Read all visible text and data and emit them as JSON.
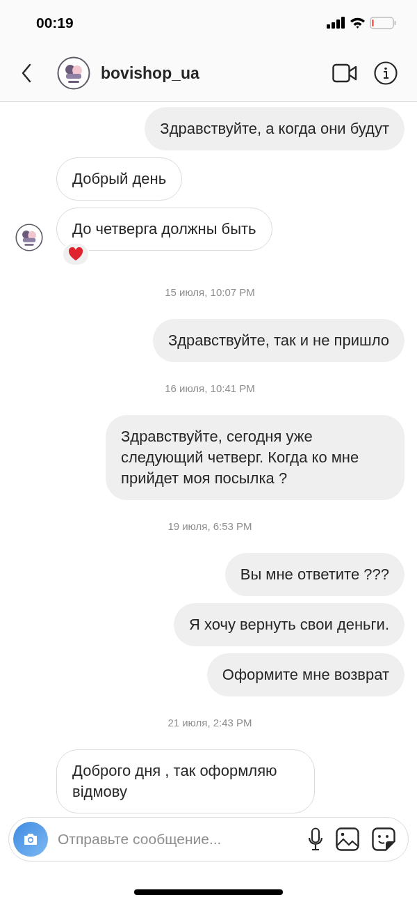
{
  "status_bar": {
    "time": "00:19"
  },
  "header": {
    "username": "bovishop_ua"
  },
  "messages": [
    {
      "kind": "sent",
      "text": "Здравствуйте, а когда они будут"
    },
    {
      "kind": "received",
      "text": "Добрый день",
      "avatar": false
    },
    {
      "kind": "received",
      "text": "До четверга должны быть",
      "avatar": true,
      "reacted": true
    },
    {
      "kind": "timestamp",
      "text": "15 июля, 10:07 PM"
    },
    {
      "kind": "sent",
      "text": "Здравствуйте, так и не пришло"
    },
    {
      "kind": "timestamp",
      "text": "16 июля, 10:41 PM"
    },
    {
      "kind": "sent",
      "text": "Здравствуйте, сегодня уже следующий четверг. Когда ко мне прийдет моя посылка ?"
    },
    {
      "kind": "timestamp",
      "text": "19 июля, 6:53 PM"
    },
    {
      "kind": "sent",
      "text": "Вы мне ответите ???"
    },
    {
      "kind": "sent",
      "text": "Я хочу вернуть свои деньги."
    },
    {
      "kind": "sent",
      "text": "Оформите мне возврат"
    },
    {
      "kind": "timestamp",
      "text": "21 июля, 2:43 PM"
    },
    {
      "kind": "received",
      "text": "Доброго дня , так оформляю відмову",
      "avatar": false
    }
  ],
  "composer": {
    "placeholder": "Отправьте сообщение..."
  }
}
